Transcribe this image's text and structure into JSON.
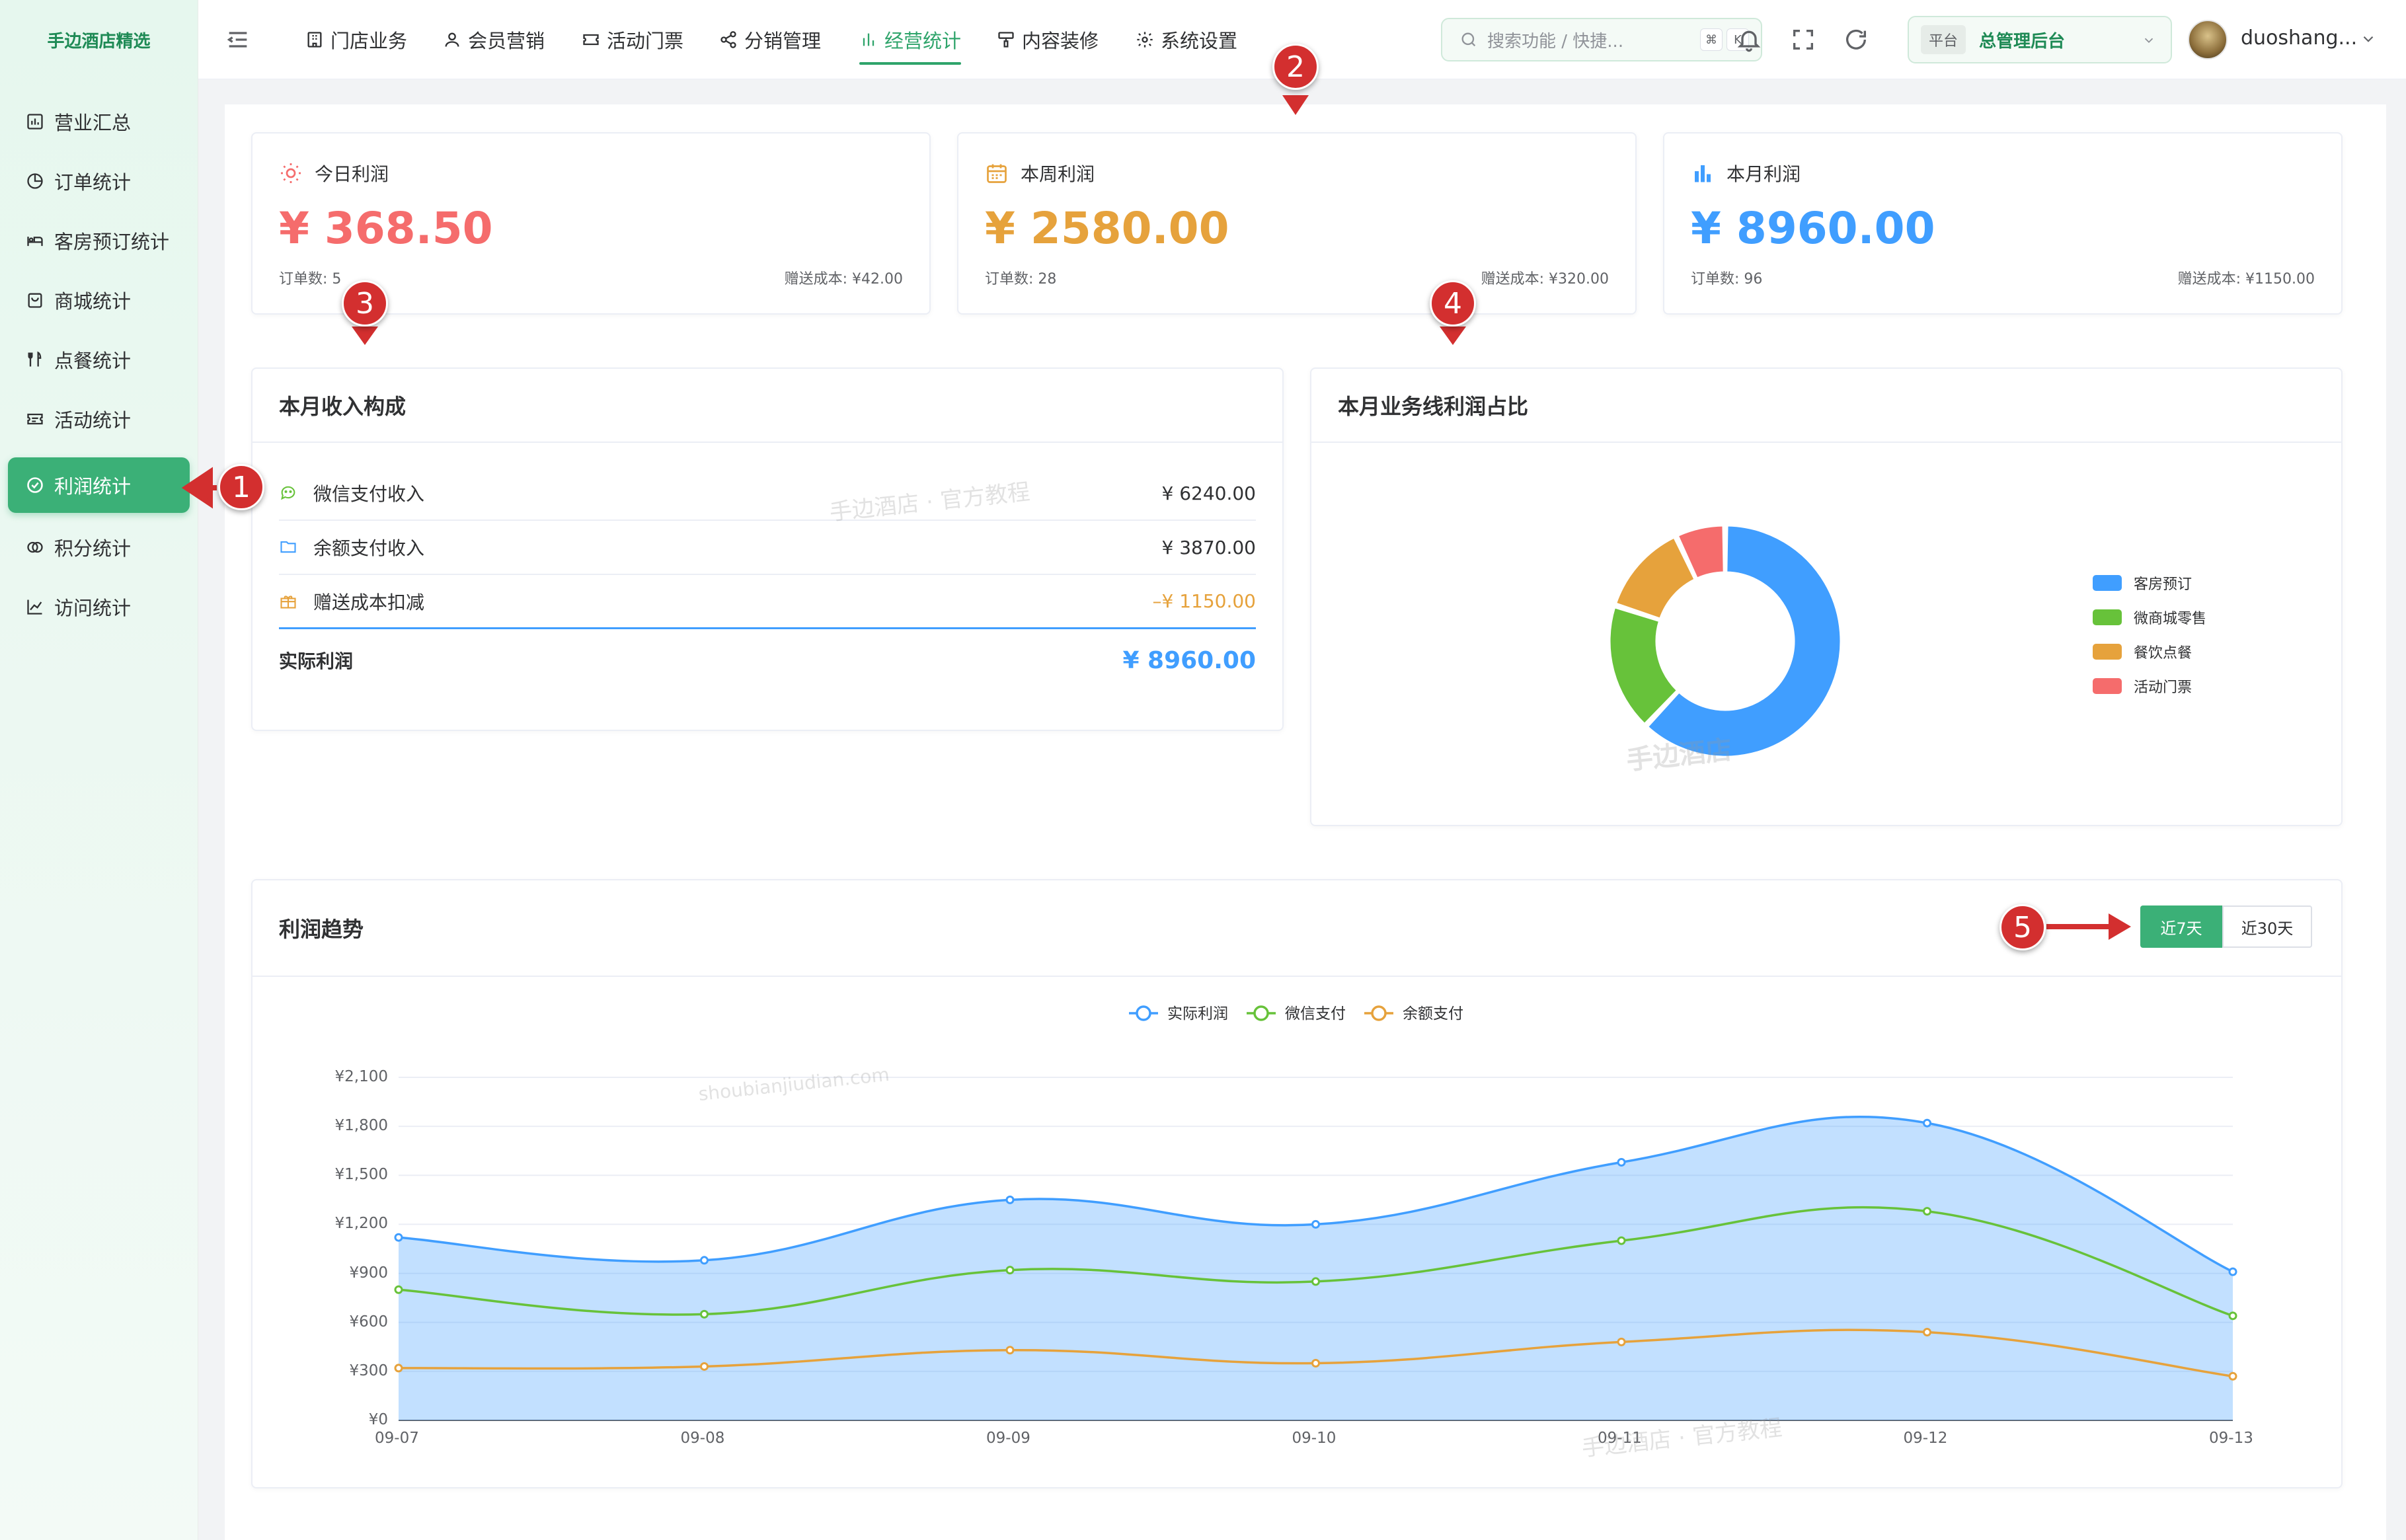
{
  "app": {
    "logo_text": "手边酒店精选"
  },
  "sidebar": {
    "items": [
      {
        "label": "营业汇总",
        "icon": "bar-chart-icon"
      },
      {
        "label": "订单统计",
        "icon": "pie-icon"
      },
      {
        "label": "客房预订统计",
        "icon": "bed-icon"
      },
      {
        "label": "商城统计",
        "icon": "shop-icon"
      },
      {
        "label": "点餐统计",
        "icon": "cutlery-icon"
      },
      {
        "label": "活动统计",
        "icon": "ticket-icon"
      },
      {
        "label": "利润统计",
        "icon": "check-circle-icon",
        "active": true
      },
      {
        "label": "积分统计",
        "icon": "coins-icon"
      },
      {
        "label": "访问统计",
        "icon": "line-chart-icon"
      }
    ]
  },
  "topnav": {
    "items": [
      {
        "label": "门店业务",
        "icon": "building-icon"
      },
      {
        "label": "会员营销",
        "icon": "user-icon"
      },
      {
        "label": "活动门票",
        "icon": "ticket-icon"
      },
      {
        "label": "分销管理",
        "icon": "share-icon"
      },
      {
        "label": "经营统计",
        "icon": "bar-chart-icon",
        "active": true
      },
      {
        "label": "内容装修",
        "icon": "brush-icon"
      },
      {
        "label": "系统设置",
        "icon": "gear-icon"
      }
    ],
    "search_placeholder": "搜索功能 / 快捷...",
    "kbd_cmd": "⌘",
    "kbd_k": "K",
    "platform_tag": "平台",
    "platform_name": "总管理后台",
    "username": "duoshang..."
  },
  "stats": [
    {
      "title": "今日利润",
      "value": "¥ 368.50",
      "orders": "订单数: 5",
      "cost": "赠送成本: ¥42.00",
      "color": "#f56c6c",
      "icon": "sun-icon"
    },
    {
      "title": "本周利润",
      "value": "¥ 2580.00",
      "orders": "订单数: 28",
      "cost": "赠送成本: ¥320.00",
      "color": "#e6a23c",
      "icon": "calendar-icon"
    },
    {
      "title": "本月利润",
      "value": "¥ 8960.00",
      "orders": "订单数: 96",
      "cost": "赠送成本: ¥1150.00",
      "color": "#409eff",
      "icon": "bar-chart-icon"
    }
  ],
  "income": {
    "title": "本月收入构成",
    "rows": [
      {
        "label": "微信支付收入",
        "amount": "¥ 6240.00",
        "icon": "wechat-icon"
      },
      {
        "label": "余额支付收入",
        "amount": "¥ 3870.00",
        "icon": "folder-icon"
      },
      {
        "label": "赠送成本扣减",
        "amount": "–¥ 1150.00",
        "icon": "gift-icon"
      }
    ],
    "total_label": "实际利润",
    "total_amount": "¥ 8960.00"
  },
  "donut": {
    "title": "本月业务线利润占比",
    "legend": [
      {
        "name": "客房预订",
        "color": "#409eff"
      },
      {
        "name": "微商城零售",
        "color": "#67c23a"
      },
      {
        "name": "餐饮点餐",
        "color": "#e6a23c"
      },
      {
        "name": "活动门票",
        "color": "#f56c6c"
      }
    ]
  },
  "trend": {
    "title": "利润趋势",
    "btn_7": "近7天",
    "btn_30": "近30天"
  },
  "watermarks": {
    "a": "手边酒店 · 官方教程",
    "b": "手边酒店",
    "c": "shoubianjiudian.com",
    "d": "手边酒店 · 官方教程"
  },
  "markers": [
    "1",
    "2",
    "3",
    "4",
    "5"
  ],
  "chart_data": [
    {
      "type": "pie",
      "title": "本月业务线利润占比",
      "categories": [
        "客房预订",
        "微商城零售",
        "餐饮点餐",
        "活动门票"
      ],
      "values": [
        62,
        18,
        13,
        7
      ],
      "colors": [
        "#409eff",
        "#67c23a",
        "#e6a23c",
        "#f56c6c"
      ],
      "legend": "right"
    },
    {
      "type": "line",
      "title": "利润趋势",
      "categories": [
        "09-07",
        "09-08",
        "09-09",
        "09-10",
        "09-11",
        "09-12",
        "09-13"
      ],
      "series": [
        {
          "name": "实际利润",
          "values": [
            1120,
            980,
            1350,
            1200,
            1580,
            1820,
            910
          ],
          "color": "#409eff",
          "area": true
        },
        {
          "name": "微信支付",
          "values": [
            800,
            650,
            920,
            850,
            1100,
            1280,
            640
          ],
          "color": "#67c23a"
        },
        {
          "name": "余额支付",
          "values": [
            320,
            330,
            430,
            350,
            480,
            540,
            270
          ],
          "color": "#e6a23c"
        }
      ],
      "ylim": [
        0,
        2100
      ],
      "yticks": [
        "¥0",
        "¥300",
        "¥600",
        "¥900",
        "¥1,200",
        "¥1,500",
        "¥1,800",
        "¥2,100"
      ],
      "legend": "top-center",
      "grid": true
    }
  ]
}
